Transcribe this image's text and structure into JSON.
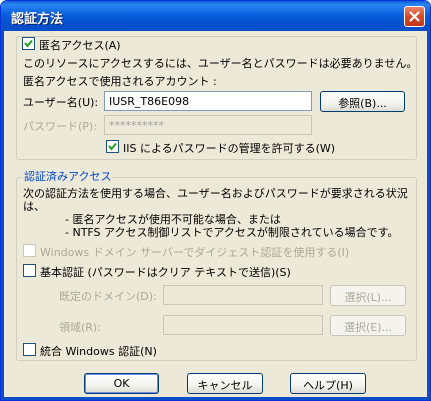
{
  "window": {
    "title": "認証方法"
  },
  "anonymous": {
    "checkbox_label": "匿名アクセス(A)",
    "checked": true,
    "desc": "このリソースにアクセスするには、ユーザー名とパスワードは必要ありません。",
    "account_label": "匿名アクセスで使用されるアカウント :",
    "username_label": "ユーザー名(U):",
    "username_value": "IUSR_T86E098",
    "browse_label": "参照(B)...",
    "password_label": "パスワード(P):",
    "password_value": "**********",
    "iis_label": "IIS によるパスワードの管理を許可する(W)",
    "iis_checked": true
  },
  "authenticated": {
    "legend": "認証済みアクセス",
    "desc_line1": "次の認証方法を使用する場合、ユーザー名およびパスワードが要求される状況",
    "desc_line2": "は、",
    "bullet1": "- 匿名アクセスが使用不可能な場合、または",
    "bullet2": "- NTFS アクセス制御リストでアクセスが制限されている場合です。",
    "digest_label": "Windows ドメイン サーバーでダイジェスト認証を使用する(I)",
    "basic_label": "基本認証 (パスワードはクリア テキストで送信)(S)",
    "default_domain_label": "既定のドメイン(D):",
    "default_domain_select": "選択(L)...",
    "realm_label": "領域(R):",
    "realm_select": "選択(E)...",
    "integrated_label": "統合 Windows 認証(N)"
  },
  "buttons": {
    "ok": "OK",
    "cancel": "キャンセル",
    "help": "ヘルプ(H)"
  },
  "colors": {
    "titlebar": "#0a5fd8",
    "dialog_bg": "#ece9d8",
    "group_legend": "#0046d5",
    "disabled_text": "#aca899"
  }
}
